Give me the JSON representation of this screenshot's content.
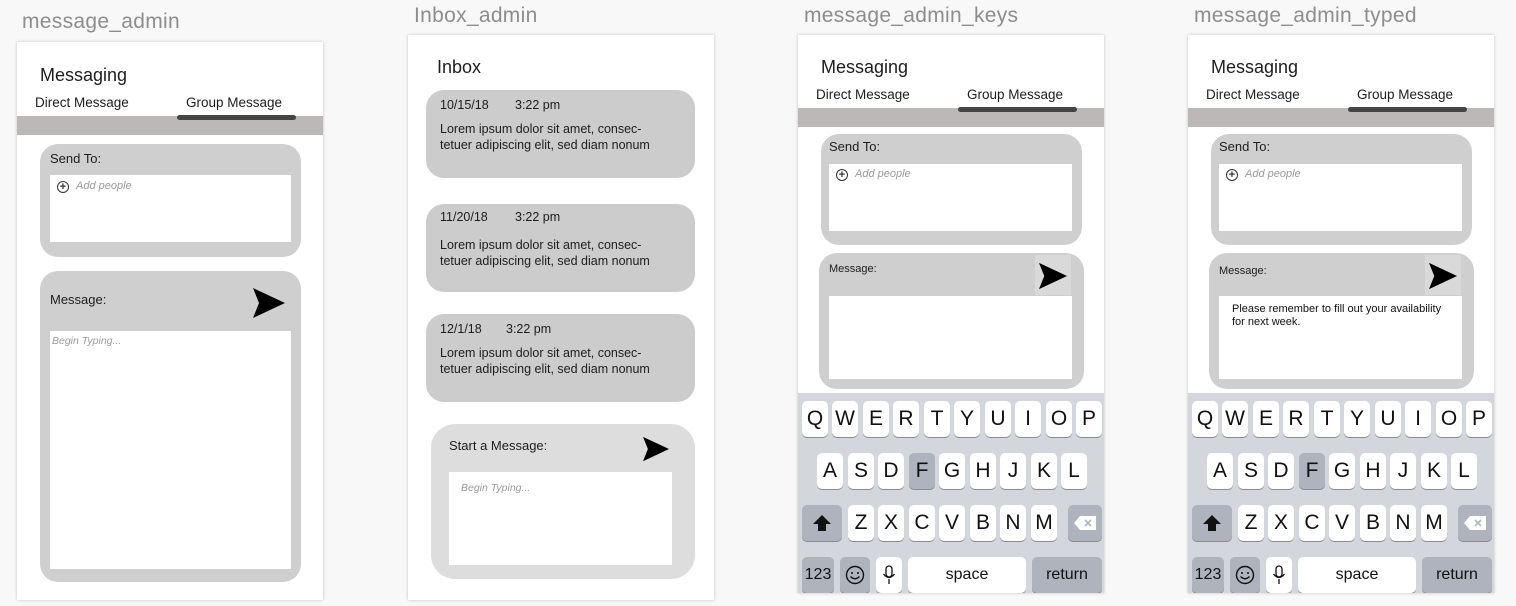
{
  "screens": {
    "s1": {
      "board_title": "message_admin",
      "title": "Messaging",
      "tabs": [
        "Direct Message",
        "Group Message"
      ],
      "send_to_label": "Send To:",
      "add_people_placeholder": "Add people",
      "message_label": "Message:",
      "message_placeholder": "Begin Typing..."
    },
    "s2": {
      "board_title": "Inbox_admin",
      "title": "Inbox",
      "messages": [
        {
          "date": "10/15/18",
          "time": "3:22 pm",
          "line1": "Lorem ipsum dolor sit amet, consec-",
          "line2": "tetuer adipiscing elit, sed diam nonum"
        },
        {
          "date": "11/20/18",
          "time": "3:22 pm",
          "line1": "Lorem ipsum dolor sit amet, consec-",
          "line2": "tetuer adipiscing elit, sed diam nonum"
        },
        {
          "date": "12/1/18",
          "time": "3:22 pm",
          "line1": "Lorem ipsum dolor sit amet, consec-",
          "line2": "tetuer adipiscing elit, sed diam nonum"
        }
      ],
      "start_label": "Start a Message:",
      "start_placeholder": "Begin Typing..."
    },
    "s3": {
      "board_title": "message_admin_keys",
      "title": "Messaging",
      "tabs": [
        "Direct Message",
        "Group Message"
      ],
      "send_to_label": "Send To:",
      "add_people_placeholder": "Add people",
      "message_label": "Message:"
    },
    "s4": {
      "board_title": "message_admin_typed",
      "title": "Messaging",
      "tabs": [
        "Direct Message",
        "Group Message"
      ],
      "send_to_label": "Send To:",
      "add_people_placeholder": "Add people",
      "message_label": "Message:",
      "typed_line1": "Please remember to fill out your availability",
      "typed_line2": "for next week."
    }
  },
  "keyboard": {
    "row1": [
      "Q",
      "W",
      "E",
      "R",
      "T",
      "Y",
      "U",
      "I",
      "O",
      "P"
    ],
    "row2": [
      "A",
      "S",
      "D",
      "F",
      "G",
      "H",
      "J",
      "K",
      "L"
    ],
    "row3": [
      "Z",
      "X",
      "C",
      "V",
      "B",
      "N",
      "M"
    ],
    "num_label": "123",
    "space_label": "space",
    "return_label": "return",
    "highlighted_key": "F"
  },
  "colors": {
    "panel": "#cfcfcf",
    "tab_bar": "#bdb8b8",
    "keyboard_bg": "#d3d6dc",
    "key_dark": "#aeb3bd"
  }
}
